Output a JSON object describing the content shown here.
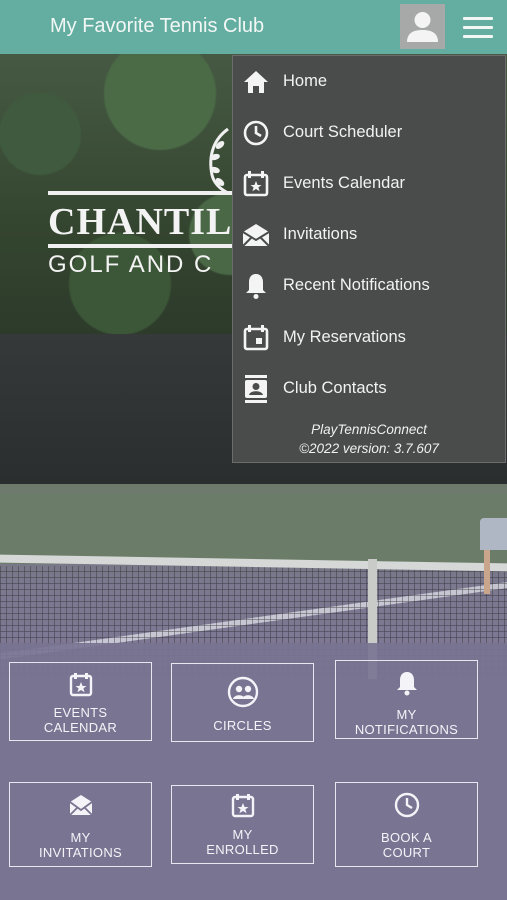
{
  "header": {
    "title": "My Favorite Tennis Club",
    "avatar_icon": "user-avatar-icon",
    "menu_icon": "hamburger-menu-icon"
  },
  "logo": {
    "main": "CHANTILL",
    "sub": "GOLF AND C"
  },
  "menu": {
    "items": [
      {
        "label": "Home",
        "icon": "home-icon"
      },
      {
        "label": "Court Scheduler",
        "icon": "clock-icon"
      },
      {
        "label": "Events Calendar",
        "icon": "calendar-star-icon"
      },
      {
        "label": "Invitations",
        "icon": "envelope-icon"
      },
      {
        "label": "Recent Notifications",
        "icon": "bell-icon"
      },
      {
        "label": "My Reservations",
        "icon": "calendar-icon"
      },
      {
        "label": "Club Contacts",
        "icon": "contacts-icon"
      }
    ],
    "brand": "PlayTennisConnect",
    "version": "©2022 version: 3.7.607"
  },
  "tiles": [
    {
      "line1": "EVENTS",
      "line2": "CALENDAR",
      "icon": "calendar-star-icon"
    },
    {
      "line1": "CIRCLES",
      "line2": "",
      "icon": "group-icon"
    },
    {
      "line1": "MY",
      "line2": "NOTIFICATIONS",
      "icon": "bell-icon"
    },
    {
      "line1": "MY",
      "line2": "INVITATIONS",
      "icon": "envelope-icon"
    },
    {
      "line1": "MY",
      "line2": "ENROLLED",
      "icon": "calendar-star-icon"
    },
    {
      "line1": "BOOK A",
      "line2": "COURT",
      "icon": "clock-icon"
    }
  ],
  "colors": {
    "header": "#63ada1",
    "menu_bg": "#4a4b4b",
    "tile_bg": "#7a7492"
  }
}
